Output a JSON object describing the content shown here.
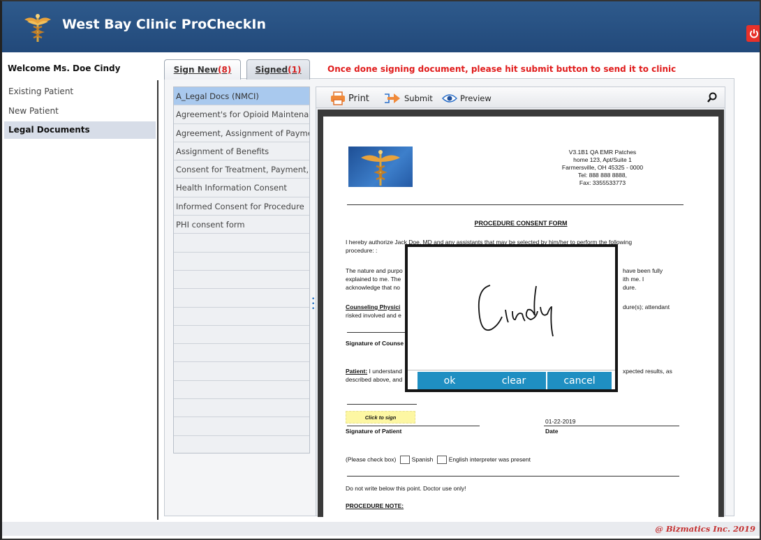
{
  "header": {
    "title": "West Bay Clinic ProCheckIn",
    "logo_icon": "caduceus-icon",
    "power_icon": "power-icon"
  },
  "sidebar": {
    "welcome": "Welcome Ms. Doe Cindy",
    "items": [
      {
        "label": "Existing Patient",
        "active": false
      },
      {
        "label": "New Patient",
        "active": false
      },
      {
        "label": "Legal Documents",
        "active": true
      }
    ]
  },
  "tabs": {
    "sign_new": {
      "label": "Sign New",
      "count": "(8)"
    },
    "signed": {
      "label": "Signed",
      "count": "(1)"
    }
  },
  "notice": "Once done signing document, please hit submit button to send it to clinic",
  "documents": [
    "A_Legal Docs (NMCI)",
    "Agreement's for Opioid Maintenanc...",
    "Agreement, Assignment of Paymen...",
    "Assignment of Benefits",
    "Consent for Treatment, Payment,...",
    "Health Information Consent",
    "Informed Consent for Procedure",
    "PHI consent form"
  ],
  "toolbar": {
    "print": "Print",
    "submit": "Submit",
    "preview": "Preview"
  },
  "paper": {
    "clinic_lines": [
      "V3.1B1 QA EMR Patches",
      "home 123, Apt/Suite 1",
      "Farmersville, OH 45325 - 0000",
      "Tel: 888 888 8888,",
      "Fax: 3355533773"
    ],
    "form_title": "PROCEDURE CONSENT FORM",
    "authorize_1": "I hereby authorize Jack Doe, MD and any assistants that may be selected by him/her to perform the following",
    "authorize_2": "procedure: :",
    "nature_left_1": "The nature and purpo",
    "nature_left_2": "explained to me. The",
    "nature_left_3": "acknowledge that no",
    "nature_right_1": "have been fully",
    "nature_right_2": "ith me. I",
    "nature_right_3": "dure.",
    "counseling_left": "Counseling Physici",
    "counseling_right": "dure(s); attendant",
    "counseling_2": "risked involved and e",
    "sig_counselor": "Signature of Counse",
    "patient_label": "Patient:",
    "patient_left": " I understand",
    "patient_right": "xpected results, as",
    "patient_2": "described above, and",
    "click_to_sign": "Click to sign",
    "date_value": "01-22-2019",
    "sig_patient": "Signature of Patient",
    "date_label": "Date",
    "check_prefix": "(Please check box)",
    "check_spanish": "Spanish",
    "check_english": "English interpreter was present",
    "doctor_only": "Do not write below this point. Doctor use only!",
    "procedure_note": "PROCEDURE NOTE:"
  },
  "signature_modal": {
    "ok": "ok",
    "clear": "clear",
    "cancel": "cancel"
  },
  "footer": "@ Bizmatics Inc. 2019",
  "colors": {
    "header": "#2e5a8c",
    "accent_red": "#e01c1c",
    "modal_button": "#1f8fc2",
    "selected_doc": "#a9c9ee"
  }
}
